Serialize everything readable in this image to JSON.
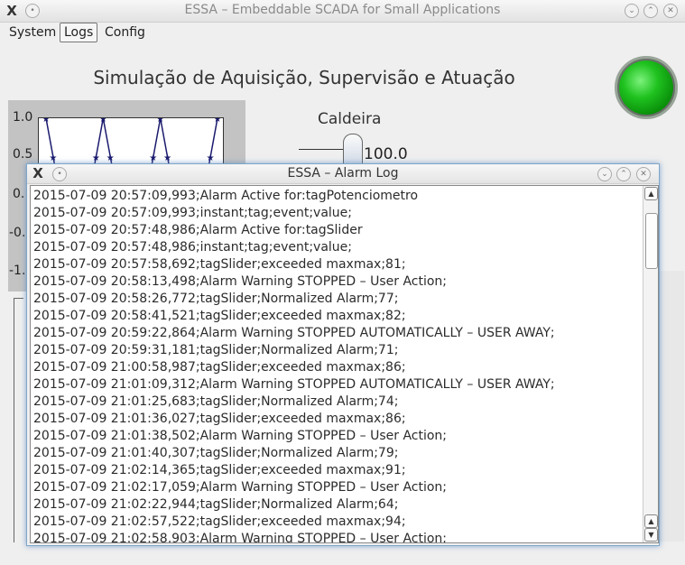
{
  "window": {
    "title": "ESSA – Embeddable SCADA for Small Applications",
    "logo_glyph": "X"
  },
  "menu": {
    "items": [
      "System",
      "Logs",
      "Config"
    ]
  },
  "main": {
    "heading": "Simulação de Aquisição, Supervisão e Atuação",
    "led_color": "#1fc21f",
    "plot": {
      "y_ticks": [
        "1.0",
        "0.5",
        "0.",
        "-0.",
        "-1."
      ]
    },
    "slider": {
      "label": "Caldeira",
      "value": "100.0"
    }
  },
  "chart_data": {
    "type": "line",
    "title": "",
    "xlabel": "",
    "ylabel": "",
    "ylim": [
      -1.0,
      1.0
    ],
    "series": [
      {
        "values": [
          1.0,
          0.5,
          0.0,
          -0.5,
          -1.0,
          -0.5,
          0.0,
          0.5,
          1.0,
          0.5,
          0.0,
          -0.5,
          -1.0,
          -0.5,
          0.0,
          0.5,
          1.0,
          0.5,
          0.0,
          -0.5,
          -1.0,
          -0.5,
          0.0,
          0.5,
          1.0
        ],
        "color": "#1a1a6e"
      }
    ]
  },
  "alarm_log": {
    "title": "ESSA – Alarm Log",
    "lines": [
      "2015-07-09 20:57:09,993;Alarm Active for:tagPotenciometro",
      "2015-07-09 20:57:09,993;instant;tag;event;value;",
      "2015-07-09 20:57:48,986;Alarm Active for:tagSlider",
      "2015-07-09 20:57:48,986;instant;tag;event;value;",
      "2015-07-09 20:57:58,692;tagSlider;exceeded maxmax;81;",
      "2015-07-09 20:58:13,498;Alarm Warning STOPPED – User Action;",
      "2015-07-09 20:58:26,772;tagSlider;Normalized Alarm;77;",
      "2015-07-09 20:58:41,521;tagSlider;exceeded maxmax;82;",
      "2015-07-09 20:59:22,864;Alarm Warning STOPPED AUTOMATICALLY – USER AWAY;",
      "2015-07-09 20:59:31,181;tagSlider;Normalized Alarm;71;",
      "2015-07-09 21:00:58,987;tagSlider;exceeded maxmax;86;",
      "2015-07-09 21:01:09,312;Alarm Warning STOPPED AUTOMATICALLY – USER AWAY;",
      "2015-07-09 21:01:25,683;tagSlider;Normalized Alarm;74;",
      "2015-07-09 21:01:36,027;tagSlider;exceeded maxmax;86;",
      "2015-07-09 21:01:38,502;Alarm Warning STOPPED – User Action;",
      "2015-07-09 21:01:40,307;tagSlider;Normalized Alarm;79;",
      "2015-07-09 21:02:14,365;tagSlider;exceeded maxmax;91;",
      "2015-07-09 21:02:17,059;Alarm Warning STOPPED – User Action;",
      "2015-07-09 21:02:22,944;tagSlider;Normalized Alarm;64;",
      "2015-07-09 21:02:57,522;tagSlider;exceeded maxmax;94;",
      "2015-07-09 21:02:58,903;Alarm Warning STOPPED – User Action;"
    ]
  },
  "icons": {
    "minimize": "⌄",
    "maximize": "⌃",
    "close": "✕",
    "menu_dot": "•",
    "scroll_up": "▲",
    "scroll_down": "▼"
  }
}
